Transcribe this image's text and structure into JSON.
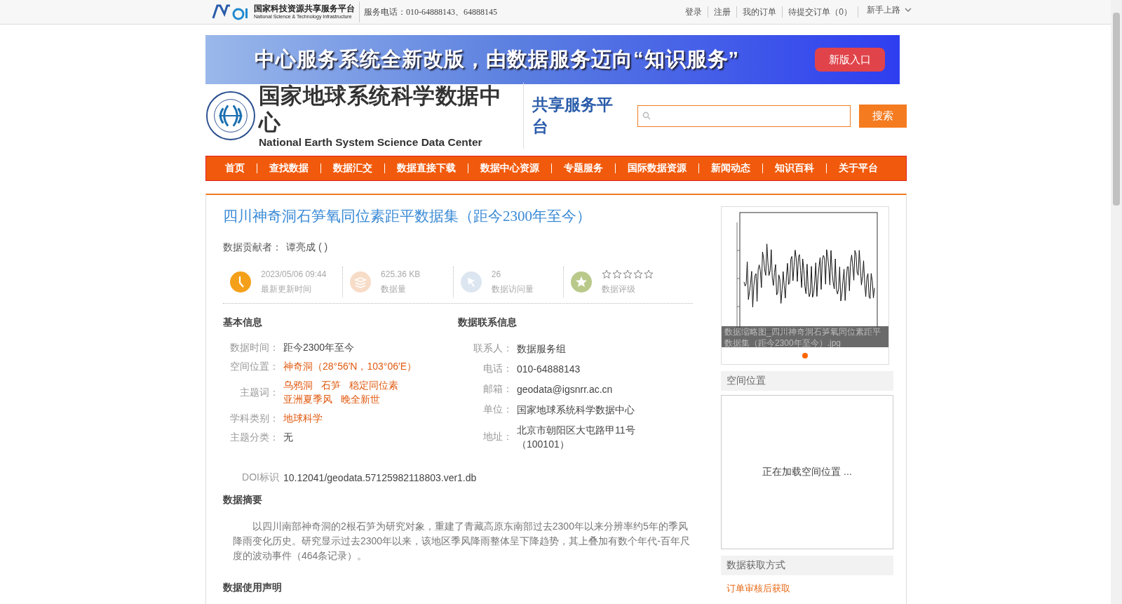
{
  "top_bar": {
    "logo_title": "国家科技资源共享服务平台",
    "logo_subtitle": "National Science & Technology Infrastructure",
    "phone": "服务电话：010-64888143、64888145",
    "links": [
      "登录",
      "注册",
      "我的订单",
      "待提交订单（0）"
    ],
    "guide": "新手上路"
  },
  "banner": {
    "text": "中心服务系统全新改版，由数据服务迈向“知识服务”",
    "button": "新版入口"
  },
  "header": {
    "name_cn": "国家地球系统科学数据中心",
    "name_en": "National Earth System Science Data Center",
    "platform": "共享服务平台",
    "search_button": "搜索"
  },
  "nav": [
    "首页",
    "查找数据",
    "数据汇交",
    "数据直接下载",
    "数据中心资源",
    "专题服务",
    "国际数据资源",
    "新闻动态",
    "知识百科",
    "关于平台"
  ],
  "dataset": {
    "title": "四川神奇洞石笋氧同位素距平数据集（距今2300年至今）",
    "contributor_label": "数据贡献者：",
    "contributor": "谭亮成 ( )",
    "stats": [
      {
        "kind": "time",
        "value": "2023/05/06 09:44",
        "label": "最新更新时间"
      },
      {
        "kind": "size",
        "value": "625.36 KB",
        "label": "数据量"
      },
      {
        "kind": "visits",
        "value": "26",
        "label": "数据访问量"
      },
      {
        "kind": "rating",
        "stars": 0,
        "label": "数据评级"
      }
    ],
    "basic_title": "基本信息",
    "basic": [
      {
        "label": "数据时间：",
        "value": "距今2300年至今",
        "kind": "plain"
      },
      {
        "label": "空间位置：",
        "value": "神奇洞（28°56′N，103°06′E）",
        "kind": "link"
      },
      {
        "label": "主题词：",
        "kind": "tags",
        "tags": [
          "乌鸦洞",
          "石笋",
          "稳定同位素",
          "亚洲夏季风",
          "晚全新世"
        ]
      },
      {
        "label": "学科类别：",
        "value": "地球科学",
        "kind": "link"
      },
      {
        "label": "主题分类：",
        "value": "无",
        "kind": "plain"
      }
    ],
    "contact_title": "数据联系信息",
    "contact": [
      {
        "label": "联系人：",
        "value": "数据服务组"
      },
      {
        "label": "电话：",
        "value": "010-64888143"
      },
      {
        "label": "邮箱：",
        "value": "geodata@igsnrr.ac.cn"
      },
      {
        "label": "单位：",
        "value": "国家地球系统科学数据中心"
      },
      {
        "label": "地址：",
        "value": "北京市朝阳区大屯路甲11号（100101）"
      }
    ],
    "doi_label": "DOI标识",
    "doi": "10.12041/geodata.57125982118803.ver1.db",
    "abstract_title": "数据摘要",
    "abstract": "以四川南部神奇洞的2根石笋为研究对象，重建了青藏高原东南部过去2300年以来分辨率约5年的季风降雨变化历史。研究显示过去2300年以来，该地区季风降雨整体呈下降趋势，其上叠加有数个年代-百年尺度的波动事件（464条记录）。",
    "usage_title": "数据使用声明"
  },
  "sidebar": {
    "thumbnail_caption": "数据缩略图_四川神奇洞石笋氧同位素距平数据集（距今2300年至今）.jpg",
    "location_title": "空间位置",
    "location_loading": "正在加载空间位置 ...",
    "access_title": "数据获取方式",
    "access_value": "订单审核后获取"
  }
}
